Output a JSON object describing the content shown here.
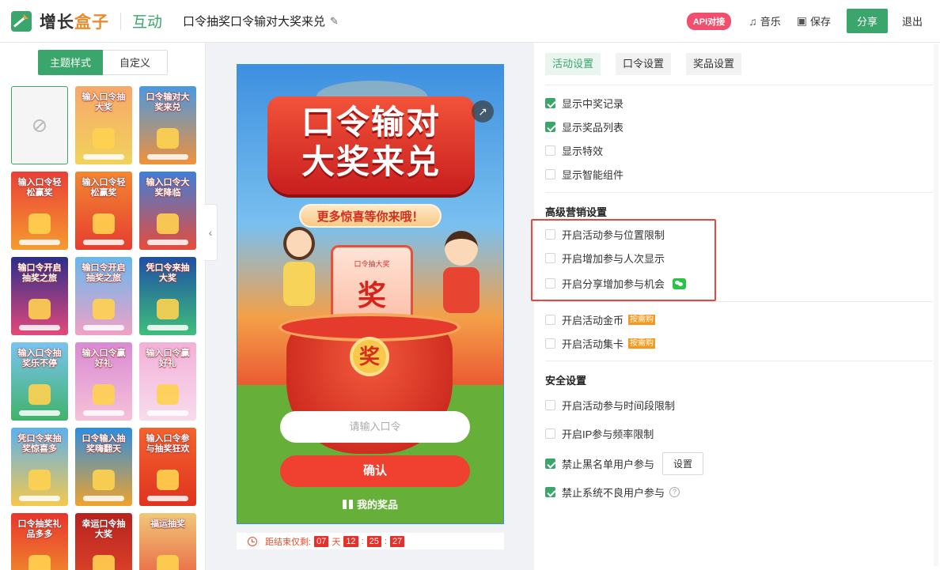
{
  "header": {
    "logo_text_a": "增长",
    "logo_text_b": "盒子",
    "module": "互动",
    "page_title": "口令抽奖口令输对大奖来兑",
    "api_badge": "API对接",
    "music_label": "音乐",
    "save_label": "保存",
    "share_label": "分享",
    "exit_label": "退出"
  },
  "left": {
    "tab_theme": "主题样式",
    "tab_custom": "自定义",
    "themes": [
      {
        "title": "",
        "colors": [
          "#f4f4f4",
          "#f4f4f4"
        ]
      },
      {
        "title": "输入口令抽大奖",
        "colors": [
          "#f7a76a",
          "#f1d35b"
        ]
      },
      {
        "title": "口令输对大奖来兑",
        "colors": [
          "#4a98e2",
          "#f0923a"
        ]
      },
      {
        "title": "输入口令轻松赢奖",
        "colors": [
          "#ea3f37",
          "#f59b2f"
        ]
      },
      {
        "title": "输入口令轻松赢奖",
        "colors": [
          "#f28732",
          "#e63d2f"
        ]
      },
      {
        "title": "输入口令大奖降临",
        "colors": [
          "#3f7fd8",
          "#e84b3b"
        ]
      },
      {
        "title": "输口令开启抽奖之旅",
        "colors": [
          "#2a2f8c",
          "#e5487a"
        ]
      },
      {
        "title": "输口令开启抽奖之旅",
        "colors": [
          "#66b8ef",
          "#f1a1c5"
        ]
      },
      {
        "title": "凭口令来抽大奖",
        "colors": [
          "#1e4fa6",
          "#3fbf7a"
        ]
      },
      {
        "title": "输入口令抽奖乐不停",
        "colors": [
          "#7ac3f2",
          "#40b36a"
        ]
      },
      {
        "title": "输入口令赢好礼",
        "colors": [
          "#d98ad3",
          "#f6c2d8"
        ]
      },
      {
        "title": "输入口令赢好礼",
        "colors": [
          "#f3b0d8",
          "#f7dced"
        ]
      },
      {
        "title": "凭口令来抽奖惊喜多",
        "colors": [
          "#5bb1ef",
          "#f5c84d"
        ]
      },
      {
        "title": "口令输入抽奖嗨翻天",
        "colors": [
          "#2b8ee0",
          "#f0a32d"
        ]
      },
      {
        "title": "输入口令参与抽奖狂欢",
        "colors": [
          "#f4632d",
          "#e0331f"
        ]
      },
      {
        "title": "口令抽奖礼品多多",
        "colors": [
          "#e8352d",
          "#f29a2d"
        ]
      },
      {
        "title": "幸运口令抽大奖",
        "colors": [
          "#b8221f",
          "#e24a2b"
        ]
      },
      {
        "title": "福运抽奖",
        "colors": [
          "#f0c87a",
          "#e8553a"
        ]
      }
    ]
  },
  "preview": {
    "title_line1": "口令输对",
    "title_line2": "大奖来兑",
    "subtitle": "更多惊喜等你来哦！",
    "card_label": "口令抽大奖",
    "card_char": "奖",
    "medal_char": "奖",
    "input_placeholder": "请输入口令",
    "confirm_label": "确认",
    "my_prizes": "我的奖品",
    "countdown_label": "距结束仅剩:",
    "days": "07",
    "days_unit": "天",
    "hours": "12",
    "minutes": "25",
    "seconds": "27",
    "sep1": ":",
    "sep2": ":"
  },
  "right": {
    "tabs": [
      "活动设置",
      "口令设置",
      "奖品设置"
    ],
    "basic": [
      {
        "label": "显示中奖记录",
        "checked": true
      },
      {
        "label": "显示奖品列表",
        "checked": true
      },
      {
        "label": "显示特效",
        "checked": false
      },
      {
        "label": "显示智能组件",
        "checked": false
      }
    ],
    "advanced_title": "高级营销设置",
    "advanced": [
      {
        "label": "开启活动参与位置限制",
        "checked": false
      },
      {
        "label": "开启增加参与人次显示",
        "checked": false
      },
      {
        "label": "开启分享增加参与机会",
        "checked": false
      },
      {
        "label": "开启活动金币",
        "checked": false,
        "tag": "按需购"
      },
      {
        "label": "开启活动集卡",
        "checked": false,
        "tag": "按需购"
      }
    ],
    "security_title": "安全设置",
    "security": [
      {
        "label": "开启活动参与时间段限制",
        "checked": false
      },
      {
        "label": "开启IP参与频率限制",
        "checked": false
      },
      {
        "label": "禁止黑名单用户参与",
        "checked": true,
        "button": "设置"
      },
      {
        "label": "禁止系统不良用户参与",
        "checked": true
      }
    ]
  },
  "colors": {
    "accent": "#3aa66b",
    "highlight": "#e04a3f",
    "tag": "#f39a1e"
  }
}
